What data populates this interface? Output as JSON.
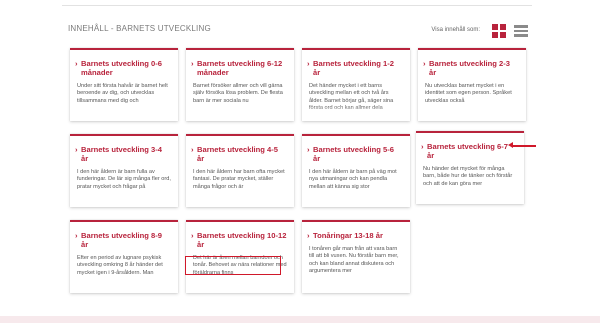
{
  "header": {
    "title": "INNEHÅLL - BARNETS UTVECKLING",
    "view_label": "Visa innehåll som:"
  },
  "view_icons": {
    "grid": "grid-view-icon",
    "list": "list-view-icon"
  },
  "colors": {
    "accent": "#b8233c",
    "annotation": "#d0182a",
    "footer": "#f7e9ec"
  },
  "cards": [
    {
      "title": "Barnets utveckling 0-6 månader",
      "text": "Under sitt första halvår är barnet helt beroende av dig, och utvecklas tillsammans med dig och"
    },
    {
      "title": "Barnets utveckling 6-12 månader",
      "text": "Barnet försöker allmer och vill gärna själv försöka lösa problem. De flesta barn är mer sociala nu"
    },
    {
      "title": "Barnets utveckling 1-2 år",
      "text": "Det händer mycket i ett barns utveckling mellan ett och två års ålder. Barnet börjar gå, säger sina första ord och kan allmer dela"
    },
    {
      "title": "Barnets utveckling 2-3 år",
      "text": "Nu utvecklas barnet mycket i en identitet som egen person. Språket utvecklas också"
    },
    {
      "title": "Barnets utveckling 3-4 år",
      "text": "I den här åldern är barn fulla av funderingar. De lär sig många fler ord, pratar mycket och frågar på"
    },
    {
      "title": "Barnets utveckling 4-5 år",
      "text": "I den här åldern har barn ofta mycket fantasi. De pratar mycket, ställer många frågor och är"
    },
    {
      "title": "Barnets utveckling 5-6 år",
      "text": "I den här åldern är barn på väg mot nya utmaningar och kan pendla mellan att känna sig stor"
    },
    {
      "title": "Barnets utveckling 6-7 år",
      "text": "Nu händer det mycket för många barn, både hur de tänker och förstår och att de kan göra mer"
    },
    {
      "title": "Barnets utveckling 8-9 år",
      "text": "Efter en period av lugnare psykisk utveckling omkring 8 år händer det mycket igen i 9-årsåldern. Man"
    },
    {
      "title": "Barnets utveckling 10-12 år",
      "text": "Det här är åren mellan barndom och tonår. Behovet av nära relationer med föräldrarna finns"
    },
    {
      "title": "Tonåringar 13-18 år",
      "text": "I tonåren går man från att vara barn till att bli vuxen. Nu förstår barn mer, och kan bland annat diskutera och argumentera mer"
    }
  ]
}
